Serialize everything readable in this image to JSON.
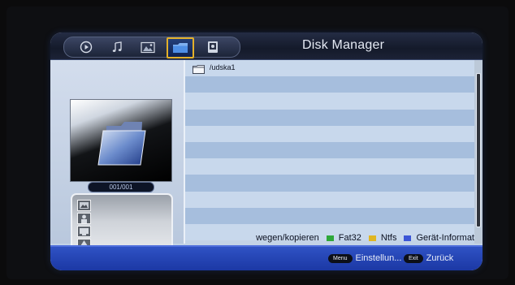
{
  "header": {
    "title": "Disk Manager",
    "tabs": [
      {
        "icon": "movie-icon",
        "active": false
      },
      {
        "icon": "music-icon",
        "active": false
      },
      {
        "icon": "photo-icon",
        "active": false
      },
      {
        "icon": "folder-icon",
        "active": true
      },
      {
        "icon": "disk-icon",
        "active": false
      }
    ]
  },
  "left_panel": {
    "counter": "001/001",
    "file_types": [
      {
        "icon": "image-type-icon"
      },
      {
        "icon": "person-type-icon"
      },
      {
        "icon": "monitor-type-icon"
      },
      {
        "icon": "tree-type-icon"
      }
    ]
  },
  "file_list": {
    "rows": [
      {
        "label": "/udska1",
        "icon": "folder-icon"
      },
      {
        "label": ""
      },
      {
        "label": ""
      },
      {
        "label": ""
      },
      {
        "label": ""
      },
      {
        "label": ""
      },
      {
        "label": ""
      },
      {
        "label": ""
      },
      {
        "label": ""
      },
      {
        "label": ""
      },
      {
        "label": ""
      }
    ]
  },
  "legend": {
    "hint": "wegen/kopieren",
    "items": [
      {
        "label": "Fat32",
        "color": "#2ea83a"
      },
      {
        "label": "Ntfs",
        "color": "#e0b622"
      },
      {
        "label": "Gerät-Informat",
        "color": "#3c56d6"
      }
    ]
  },
  "footer": {
    "menu_key": "Menu",
    "menu_label": "Einstellun...",
    "exit_key": "Exit",
    "exit_label": "Zurück"
  },
  "colors": {
    "accent_active_tab": "#e3b02a",
    "footer_bar": "#2346b8",
    "row_light": "#c8d8ec",
    "row_dark": "#a6bedd"
  }
}
